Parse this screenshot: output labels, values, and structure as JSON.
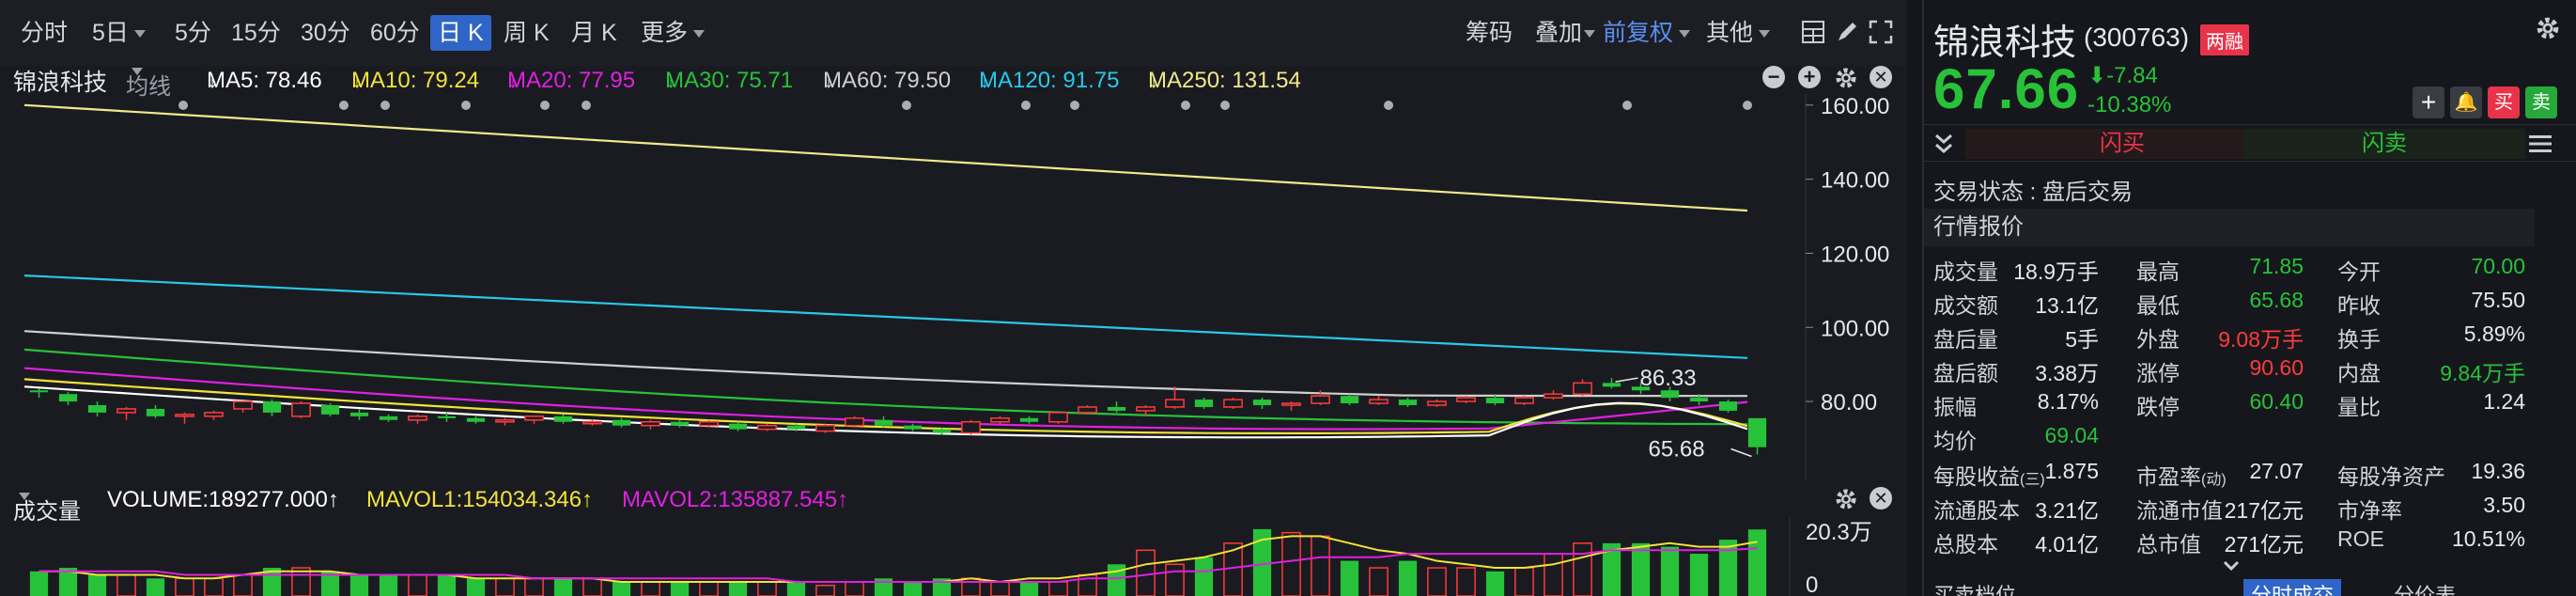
{
  "toolbar": {
    "periods": [
      "分时",
      "5日",
      "5分",
      "15分",
      "30分",
      "60分",
      "日 K",
      "周 K",
      "月 K",
      "更多"
    ],
    "active_period": "日 K",
    "chips_label": "筹码",
    "overlay_label": "叠加",
    "adjust_label": "前复权",
    "other_label": "其他"
  },
  "ma_bar": {
    "stock_name": "锦浪科技",
    "ma_type": "均线",
    "ma5": "MA5: 78.46",
    "ma10": "MA10: 79.24",
    "ma20": "MA20: 77.95",
    "ma30": "MA30: 75.71",
    "ma60": "MA60: 79.50",
    "ma120": "MA120: 91.75",
    "ma250": "MA250: 131.54",
    "arrow": "↓"
  },
  "price_axis": [
    "160.00",
    "140.00",
    "120.00",
    "100.00",
    "80.00"
  ],
  "annotations": {
    "high": "86.33",
    "low": "65.68"
  },
  "volume_bar": {
    "label": "成交量",
    "volume": "VOLUME:189277.000↑",
    "mavol1": "MAVOL1:154034.346↑",
    "mavol2": "MAVOL2:135887.545↑",
    "axis_top": "20.3万",
    "axis_bottom": "0"
  },
  "colors": {
    "up": "#ff3b3b",
    "down": "#27c23a",
    "ma5": "#ffffff",
    "ma10": "#f2e33a",
    "ma20": "#e020e0",
    "ma30": "#27c23a",
    "ma60": "#cfcfcf",
    "ma120": "#28c8e8",
    "ma250": "#f2e88a"
  },
  "quote": {
    "name": "锦浪科技",
    "code": "(300763)",
    "badge": "两融",
    "price": "67.66",
    "change": "-7.84",
    "change_pct": "-10.38%",
    "flash_buy": "闪买",
    "flash_sell": "闪卖",
    "btn_buy": "买",
    "btn_sell": "卖",
    "trade_status": "交易状态 : 盘后交易",
    "section_title": "行情报价",
    "rows": [
      [
        [
          "成交量",
          "18.9万手",
          "w"
        ],
        [
          "最高",
          "71.85",
          "g"
        ],
        [
          "今开",
          "70.00",
          "g"
        ]
      ],
      [
        [
          "成交额",
          "13.1亿",
          "w"
        ],
        [
          "最低",
          "65.68",
          "g"
        ],
        [
          "昨收",
          "75.50",
          "w"
        ]
      ],
      [
        [
          "盘后量",
          "5手",
          "w"
        ],
        [
          "外盘",
          "9.08万手",
          "r"
        ],
        [
          "换手",
          "5.89%",
          "w"
        ]
      ],
      [
        [
          "盘后额",
          "3.38万",
          "w"
        ],
        [
          "涨停",
          "90.60",
          "r"
        ],
        [
          "内盘",
          "9.84万手",
          "g"
        ]
      ],
      [
        [
          "振幅",
          "8.17%",
          "w"
        ],
        [
          "跌停",
          "60.40",
          "g"
        ],
        [
          "量比",
          "1.24",
          "w"
        ]
      ],
      [
        [
          "均价",
          "69.04",
          "g"
        ]
      ],
      [
        [
          "每股收益",
          "1.875",
          "w"
        ],
        [
          "市盈率",
          "27.07",
          "w"
        ],
        [
          "每股净资产",
          "19.36",
          "w"
        ]
      ],
      [
        [
          "流通股本",
          "3.21亿",
          "w"
        ],
        [
          "流通市值",
          "217亿元",
          "w"
        ],
        [
          "市净率",
          "3.50",
          "w"
        ]
      ],
      [
        [
          "总股本",
          "4.01亿",
          "w"
        ],
        [
          "总市值",
          "271亿元",
          "w"
        ],
        [
          "ROE",
          "10.51%",
          "w"
        ]
      ]
    ],
    "eps_sub": "(三)",
    "pe_sub": "(动)",
    "bottom_tabs": [
      "买卖档位",
      "分时成交",
      "分价表"
    ]
  },
  "chart_data": {
    "type": "candlestick",
    "ylim": [
      62,
      163
    ],
    "candles": [
      [
        83,
        83.5,
        81,
        82.5
      ],
      [
        82,
        82.5,
        79,
        80
      ],
      [
        79,
        80,
        76,
        77
      ],
      [
        77,
        78.5,
        75,
        78
      ],
      [
        78,
        79,
        75.5,
        76
      ],
      [
        76,
        77,
        74,
        76.5
      ],
      [
        76,
        77.5,
        75,
        77
      ],
      [
        78,
        80,
        77,
        80
      ],
      [
        80,
        80.5,
        76,
        77
      ],
      [
        76,
        80,
        75.5,
        79.5
      ],
      [
        79,
        79.5,
        76,
        76.5
      ],
      [
        77,
        78,
        75,
        76
      ],
      [
        76,
        76.5,
        74.5,
        75
      ],
      [
        75,
        76.5,
        74,
        76
      ],
      [
        76,
        77,
        74.5,
        75.5
      ],
      [
        75.5,
        76,
        74,
        74.5
      ],
      [
        74.5,
        75.5,
        73.5,
        75
      ],
      [
        75,
        76,
        74,
        76
      ],
      [
        76,
        76.5,
        74,
        74.5
      ],
      [
        74,
        75,
        73.5,
        74.5
      ],
      [
        75,
        75.5,
        73,
        73.5
      ],
      [
        73.5,
        75,
        72.5,
        74.5
      ],
      [
        74.5,
        75,
        73,
        73.5
      ],
      [
        73.5,
        75,
        73,
        74.5
      ],
      [
        74,
        74.5,
        72,
        72.5
      ],
      [
        72.5,
        74,
        72,
        73.5
      ],
      [
        73.5,
        74,
        72,
        72.5
      ],
      [
        72,
        74,
        71.5,
        73.5
      ],
      [
        73.5,
        76,
        73,
        75.5
      ],
      [
        75,
        76,
        73,
        73.5
      ],
      [
        73.5,
        74,
        72,
        72.5
      ],
      [
        72.5,
        73,
        71,
        71.5
      ],
      [
        71.5,
        75,
        71,
        74.5
      ],
      [
        74.5,
        76,
        74,
        75.5
      ],
      [
        75.5,
        76,
        74,
        74.5
      ],
      [
        74.5,
        77,
        74,
        77
      ],
      [
        77,
        79,
        76.5,
        78.5
      ],
      [
        78.5,
        80,
        77,
        77.5
      ],
      [
        77.5,
        79,
        76,
        78.5
      ],
      [
        78.5,
        84,
        78,
        80.5
      ],
      [
        80.5,
        81,
        78,
        78.5
      ],
      [
        78.5,
        81,
        78,
        80.5
      ],
      [
        80.5,
        81,
        78,
        79
      ],
      [
        79,
        80,
        77.5,
        79.5
      ],
      [
        79.5,
        83,
        79,
        81.5
      ],
      [
        81.5,
        82,
        79,
        79.5
      ],
      [
        79.5,
        81.5,
        79,
        80.5
      ],
      [
        80.5,
        81,
        78.5,
        79
      ],
      [
        79,
        80.5,
        78.5,
        80
      ],
      [
        80,
        81.5,
        79.5,
        81
      ],
      [
        81,
        82,
        79,
        79.5
      ],
      [
        79.5,
        81.5,
        79,
        81
      ],
      [
        81,
        83,
        80.5,
        82
      ],
      [
        82,
        86,
        81.5,
        85
      ],
      [
        85,
        86.33,
        83.5,
        84
      ],
      [
        84,
        85,
        82,
        83
      ],
      [
        83,
        84,
        80,
        81
      ],
      [
        81,
        82,
        79,
        80
      ],
      [
        80,
        80.5,
        77,
        77.5
      ],
      [
        75.5,
        70,
        65.68,
        67.66
      ]
    ],
    "volumes": [
      7,
      8,
      6,
      6,
      5,
      5,
      5,
      6,
      8,
      8,
      7,
      6,
      6,
      6,
      6,
      5,
      5,
      5,
      5,
      5,
      4,
      4,
      4,
      4,
      4,
      4,
      4,
      3,
      4,
      5,
      4,
      5,
      5,
      4,
      4,
      4,
      6,
      9,
      13,
      9,
      11,
      15,
      19,
      18,
      17,
      10,
      8,
      10,
      8,
      8,
      7,
      8,
      12,
      15,
      15,
      15,
      14,
      12,
      16,
      18.9
    ],
    "ma_lines": {
      "ma250": [
        160,
        131.54
      ],
      "ma120": [
        114,
        91.75
      ],
      "ma60": [
        99,
        79.5
      ],
      "ma30": [
        94,
        75.71
      ],
      "ma20": [
        89,
        77.95
      ],
      "ma10": [
        86,
        79.24
      ],
      "ma5": [
        84,
        78.46
      ]
    },
    "mavol1": [
      7,
      7,
      6,
      6,
      6,
      5,
      5,
      6,
      7,
      7,
      7,
      6,
      6,
      6,
      6,
      5,
      5,
      5,
      5,
      5,
      4,
      4,
      4,
      4,
      4,
      4,
      4,
      4,
      4,
      4,
      4,
      4,
      5,
      4,
      5,
      5,
      6,
      7,
      9,
      10,
      11,
      13,
      16,
      17,
      17,
      15,
      13,
      12,
      10,
      9,
      8,
      8,
      9,
      11,
      13,
      14,
      15,
      14,
      14,
      15.4
    ],
    "mavol2": [
      7,
      7,
      7,
      7,
      7,
      6,
      6,
      6,
      6,
      6,
      6,
      6,
      6,
      6,
      6,
      6,
      6,
      5,
      5,
      5,
      5,
      5,
      5,
      5,
      5,
      5,
      4,
      4,
      4,
      4,
      4,
      4,
      4,
      4,
      4,
      4,
      5,
      5,
      6,
      7,
      7,
      8,
      9,
      10,
      11,
      11,
      11,
      12,
      12,
      12,
      12,
      12,
      12,
      12,
      13,
      13,
      13,
      13,
      13,
      13.6
    ]
  }
}
